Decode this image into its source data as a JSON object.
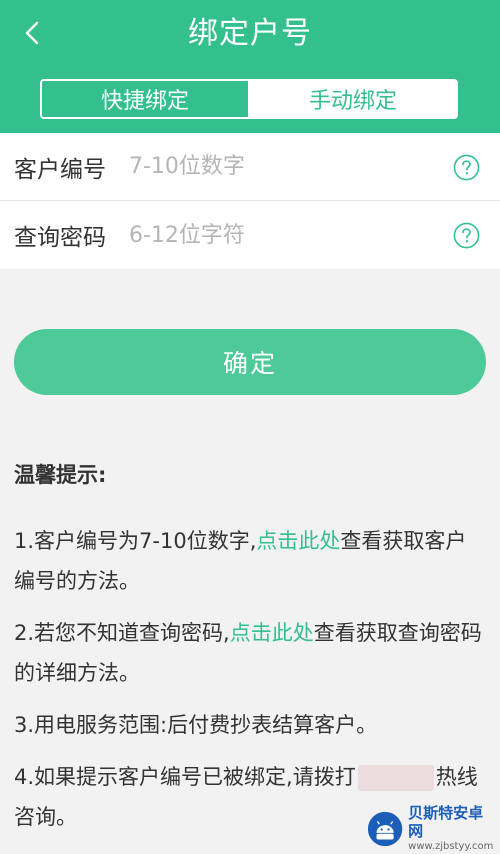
{
  "header": {
    "title": "绑定户号",
    "tabs": [
      {
        "label": "快捷绑定",
        "active": false
      },
      {
        "label": "手动绑定",
        "active": true
      }
    ]
  },
  "form": {
    "customer_id": {
      "label": "客户编号",
      "placeholder": "7-10位数字",
      "value": ""
    },
    "query_password": {
      "label": "查询密码",
      "placeholder": "6-12位字符",
      "value": ""
    }
  },
  "confirm_label": "确定",
  "tips": {
    "title": "温馨提示:",
    "item1": {
      "before": "1.客户编号为7-10位数字,",
      "link": "点击此处",
      "after": "查看获取客户编号的方法。"
    },
    "item2": {
      "before": "2.若您不知道查询密码,",
      "link": "点击此处",
      "after": "查看获取查询密码的详细方法。"
    },
    "item3": "3.用电服务范围:后付费抄表结算客户。",
    "item4": {
      "before": "4.如果提示客户编号已被绑定,请拨打",
      "after": "热线咨询。"
    }
  },
  "watermark": {
    "name": "贝斯特安卓网",
    "url": "www.zjbstyy.com"
  },
  "colors": {
    "primary": "#33c08e",
    "button": "#4dca98",
    "link": "#33c08e",
    "background": "#f2f2f2"
  },
  "icons": {
    "back": "chevron-left-icon",
    "help": "question-circle-icon"
  }
}
